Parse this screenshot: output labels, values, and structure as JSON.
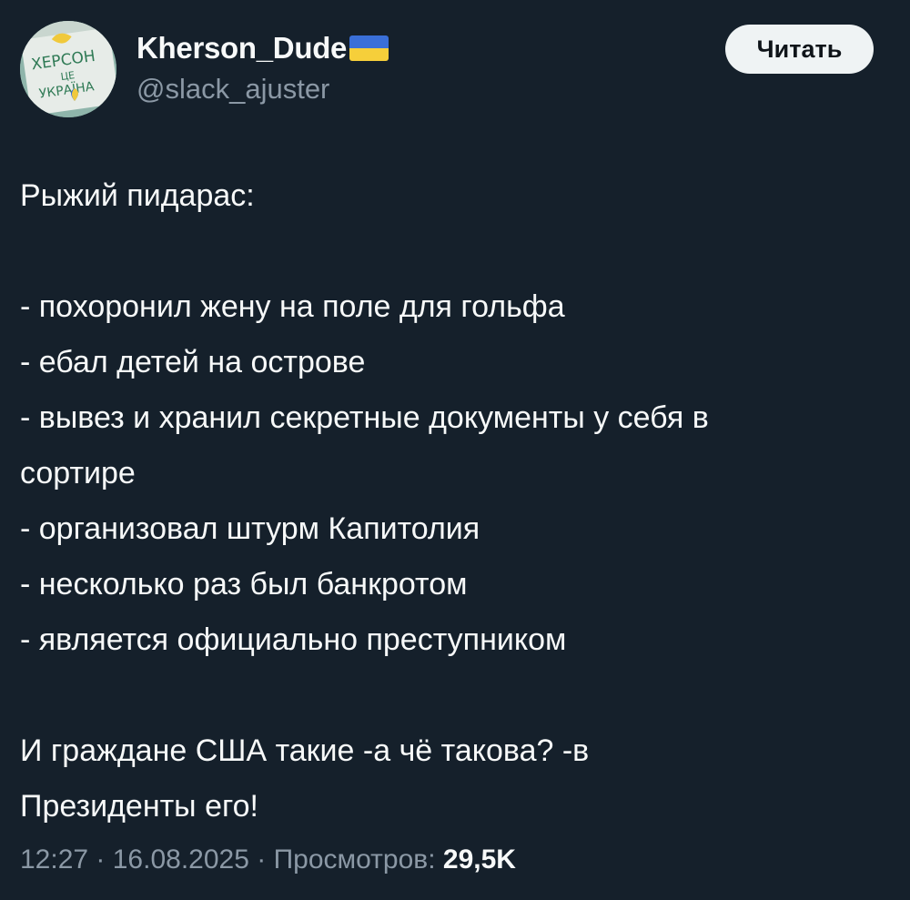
{
  "author": {
    "display_name": "Kherson_Dude",
    "handle": "@slack_ajuster",
    "avatar_text": [
      "ХЕРСОН",
      "ЦЕ",
      "УКРАЇНА"
    ],
    "flag_colors": [
      "#3a6fd8",
      "#f6cf3a"
    ]
  },
  "follow_button": {
    "label": "Читать"
  },
  "tweet": {
    "lines": [
      "Рыжий пидарас:",
      "",
      "- похоронил жену на поле для гольфа",
      "- ебал детей на острове",
      "- вывез и хранил секретные документы у себя в",
      "сортире",
      "- организовал штурм Капитолия",
      "- несколько раз был банкротом",
      "- является официально преступником",
      "",
      "И граждане США такие -а чё такова? -в",
      "Президенты его!"
    ]
  },
  "meta": {
    "time": "12:27",
    "separator": " · ",
    "date": "16.08.2025",
    "views_label": "Просмотров: ",
    "views_count": "29,5K"
  },
  "colors": {
    "background": "#15202b",
    "text": "#f7f9f9",
    "secondary": "#8b98a5",
    "button_bg": "#eff3f4"
  }
}
